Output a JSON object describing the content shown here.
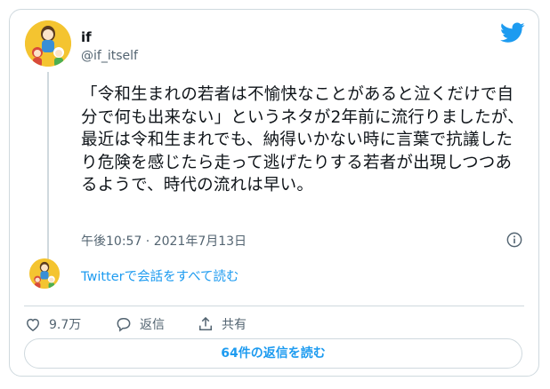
{
  "user": {
    "name": "if",
    "handle": "@if_itself"
  },
  "tweet": {
    "text": "「令和生まれの若者は不愉快なことがあると泣くだけで自分で何も出来ない」というネタが2年前に流行りましたが、最近は令和生まれでも、納得いかない時に言葉で抗議したり危険を感じたら走って逃げたりする若者が出現しつつあるようで、時代の流れは早い。",
    "timestamp": "午後10:57 · 2021年7月13日"
  },
  "conversation_link": "Twitterで会話をすべて読む",
  "actions": {
    "like_count": "9.7万",
    "reply_label": "返信",
    "share_label": "共有"
  },
  "read_replies_label": "64件の返信を読む",
  "colors": {
    "accent": "#1d9bf0",
    "secondary_text": "#536471",
    "border": "#cfd9de",
    "avatar_bg": "#f4c430"
  },
  "icons": [
    "twitter-bird-icon",
    "info-icon",
    "heart-icon",
    "reply-icon",
    "share-icon"
  ]
}
